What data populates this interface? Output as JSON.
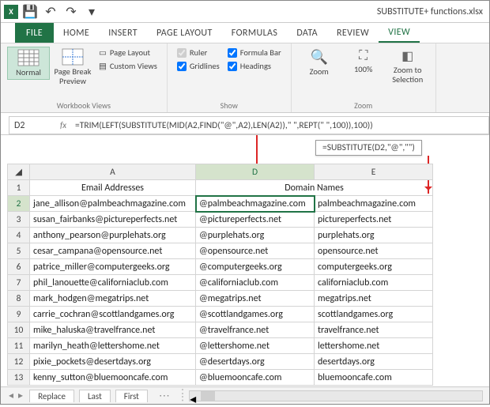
{
  "title": "SUBSTITUTE+ functions.xlsx",
  "tabs": {
    "file": "FILE",
    "home": "HOME",
    "insert": "INSERT",
    "page_layout": "PAGE LAYOUT",
    "formulas": "FORMULAS",
    "data": "DATA",
    "review": "REVIEW",
    "view": "VIEW"
  },
  "ribbon": {
    "workbook_views": {
      "label": "Workbook Views",
      "normal": "Normal",
      "page_break": "Page Break\nPreview",
      "page_layout": "Page Layout",
      "custom_views": "Custom Views"
    },
    "show": {
      "label": "Show",
      "ruler": "Ruler",
      "gridlines": "Gridlines",
      "formula_bar": "Formula Bar",
      "headings": "Headings"
    },
    "zoom": {
      "label": "Zoom",
      "zoom": "Zoom",
      "hundred": "100%",
      "zoom_selection": "Zoom to\nSelection"
    }
  },
  "namebox": "D2",
  "formula": "=TRIM(LEFT(SUBSTITUTE(MID(A2,FIND(\"@\",A2),LEN(A2)),\" \",REPT(\" \",100)),100))",
  "float_formula": "=SUBSTITUTE(D2,\"@\",\"\")",
  "col_headers": {
    "A": "A",
    "D": "D",
    "E": "E"
  },
  "headers": {
    "A": "Email Addresses",
    "DE": "Domain Names"
  },
  "rows": [
    {
      "n": 2,
      "A": "jane_allison@palmbeachmagazine.com",
      "D": "@palmbeachmagazine.com",
      "E": "palmbeachmagazine.com"
    },
    {
      "n": 3,
      "A": "susan_fairbanks@pictureperfects.net",
      "D": "@pictureperfects.net",
      "E": "pictureperfects.net"
    },
    {
      "n": 4,
      "A": "anthony_pearson@purplehats.org",
      "D": "@purplehats.org",
      "E": "purplehats.org"
    },
    {
      "n": 5,
      "A": "cesar_campana@opensource.net",
      "D": "@opensource.net",
      "E": "opensource.net"
    },
    {
      "n": 6,
      "A": "patrice_miller@computergeeks.org",
      "D": "@computergeeks.org",
      "E": "computergeeks.org"
    },
    {
      "n": 7,
      "A": "phil_lanouette@californiaclub.com",
      "D": "@californiaclub.com",
      "E": "californiaclub.com"
    },
    {
      "n": 8,
      "A": "mark_hodgen@megatrips.net",
      "D": "@megatrips.net",
      "E": "megatrips.net"
    },
    {
      "n": 9,
      "A": "carrie_cochran@scottlandgames.org",
      "D": "@scottlandgames.org",
      "E": "scottlandgames.org"
    },
    {
      "n": 10,
      "A": "mike_haluska@travelfrance.net",
      "D": "@travelfrance.net",
      "E": "travelfrance.net"
    },
    {
      "n": 11,
      "A": "marilyn_heath@lettershome.net",
      "D": "@lettershome.net",
      "E": "lettershome.net"
    },
    {
      "n": 12,
      "A": "pixie_pockets@desertdays.org",
      "D": "@desertdays.org",
      "E": "desertdays.org"
    },
    {
      "n": 13,
      "A": "kenny_sutton@bluemooncafe.com",
      "D": "@bluemooncafe.com",
      "E": "bluemooncafe.com"
    }
  ],
  "sheet_tabs": {
    "replace": "Replace",
    "last": "Last",
    "first": "First"
  },
  "icons": {
    "save": "💾",
    "undo": "↶",
    "redo": "↷",
    "dd": "▾"
  }
}
